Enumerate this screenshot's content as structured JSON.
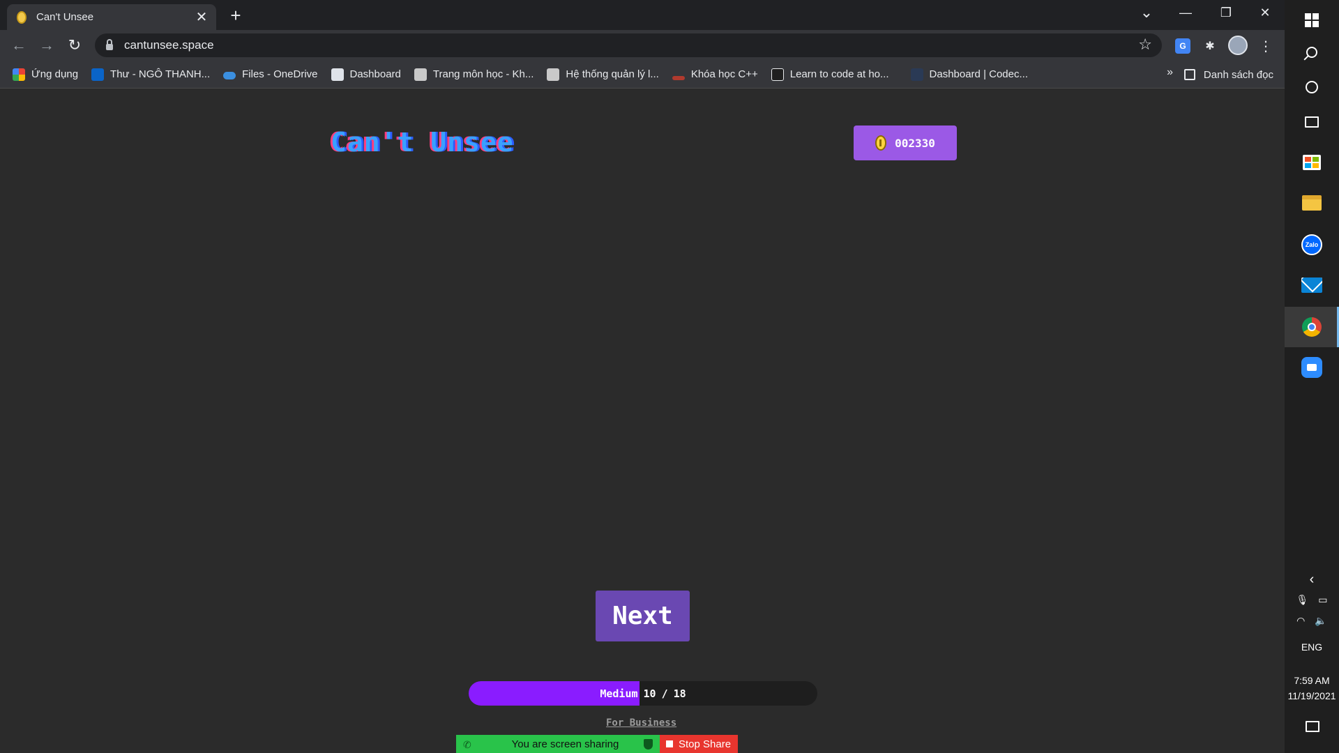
{
  "browser": {
    "tab_title": "Can't Unsee",
    "tab_close": "✕",
    "new_tab": "+",
    "url": "cantunsee.space",
    "window_controls": {
      "minimize": "—",
      "restore": "❐",
      "close": "✕",
      "tab_search": "⌄"
    },
    "bookmarks": [
      {
        "label": "Ứng dụng",
        "icon": "apps-grid-icon",
        "color": "#ea4335"
      },
      {
        "label": "Thư - NGÔ THANH...",
        "icon": "outlook-icon",
        "color": "#0a64c8"
      },
      {
        "label": "Files - OneDrive",
        "icon": "onedrive-icon",
        "color": "#3b8fe0"
      },
      {
        "label": "Dashboard",
        "icon": "moodle-icon",
        "color": "#dfe3ea"
      },
      {
        "label": "Trang môn học - Kh...",
        "icon": "course-page-icon",
        "color": "#c9c9c9"
      },
      {
        "label": "Hệ thống quản lý l...",
        "icon": "lms-icon",
        "color": "#c9c9c9"
      },
      {
        "label": "Khóa học C++",
        "icon": "cpp-course-icon",
        "color": "#b03a2e"
      },
      {
        "label": "Learn to code at ho...",
        "icon": "codecademy-icon",
        "color": "#1f1f1f"
      },
      {
        "label": "Dashboard | Codec...",
        "icon": "codecademy-dashboard-icon",
        "color": "#2a3a55"
      }
    ],
    "bookmarks_more": "»",
    "reading_list": "Danh sách đọc"
  },
  "game": {
    "logo": "Can't Unsee",
    "coins": "002330",
    "next_label": "Next",
    "progress": {
      "difficulty": "Medium",
      "current": "10",
      "separator": "/",
      "total": "18",
      "fraction": 0.49
    },
    "business_link": "For Business"
  },
  "screen_share": {
    "status": "You are screen sharing",
    "stop_label": "Stop Share"
  },
  "taskbar": {
    "language": "ENG",
    "time": "7:59 AM",
    "date": "11/19/2021"
  },
  "colors": {
    "accent_purple": "#9b59e6",
    "next_button": "#6a48b2",
    "progress_fill": "#8a1cff",
    "share_green": "#29c34a",
    "share_red": "#e8352e"
  }
}
